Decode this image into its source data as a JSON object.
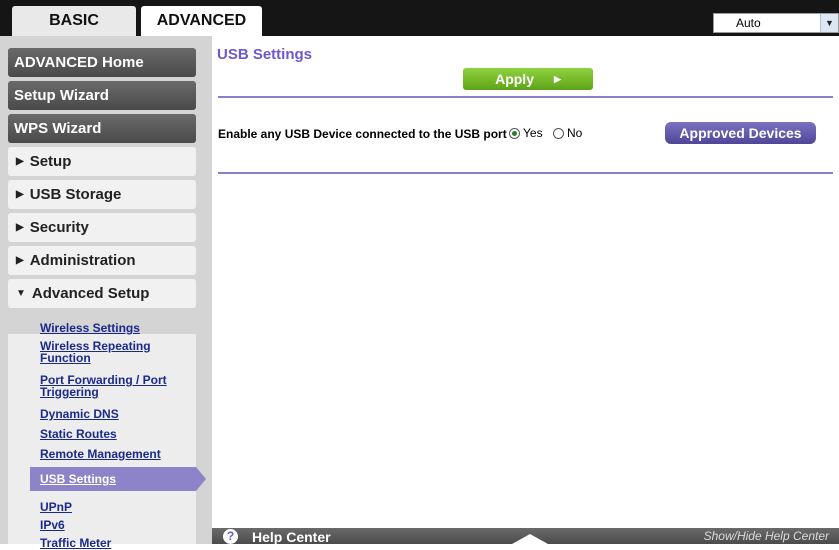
{
  "tabs": {
    "basic": "BASIC",
    "advanced": "ADVANCED"
  },
  "language_select": {
    "value": "Auto"
  },
  "sidebar": {
    "advanced_home": "ADVANCED Home",
    "setup_wizard": "Setup Wizard",
    "wps_wizard": "WPS Wizard",
    "sections": [
      "Setup",
      "USB Storage",
      "Security",
      "Administration",
      "Advanced Setup"
    ],
    "submenu": {
      "wireless_settings": "Wireless Settings",
      "wireless_repeating_1": "Wireless Repeating",
      "wireless_repeating_2": "Function",
      "port_forwarding_1": "Port Forwarding / Port",
      "port_forwarding_2": "Triggering",
      "dynamic_dns": "Dynamic DNS",
      "static_routes": "Static Routes",
      "remote_management": "Remote Management",
      "usb_settings": "USB Settings",
      "upnp": "UPnP",
      "ipv6": "IPv6",
      "traffic_meter": "Traffic Meter"
    }
  },
  "main": {
    "title": "USB Settings",
    "apply_label": "Apply",
    "usb_label": "Enable any USB Device connected to the USB port",
    "yes_label": "Yes",
    "no_label": "No",
    "selected": "Yes",
    "approved_devices_label": "Approved Devices"
  },
  "help": {
    "title": "Help Center",
    "show_hide": "Show/Hide Help Center"
  }
}
